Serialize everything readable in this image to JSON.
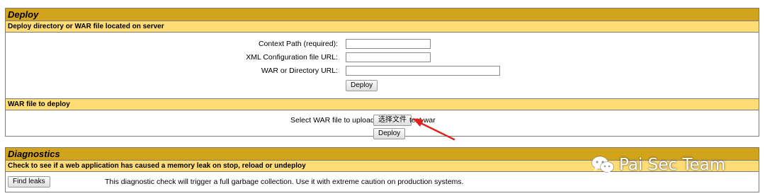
{
  "deploy": {
    "title": "Deploy",
    "server_section": {
      "title": "Deploy directory or WAR file located on server",
      "context_path_label": "Context Path (required):",
      "context_path_value": "",
      "xml_config_label": "XML Configuration file URL:",
      "xml_config_value": "",
      "war_dir_label": "WAR or Directory URL:",
      "war_dir_value": "",
      "deploy_button": "Deploy"
    },
    "upload_section": {
      "title": "WAR file to deploy",
      "select_label": "Select WAR file to upload",
      "choose_file_button": "选择文件",
      "selected_file": "test.war",
      "deploy_button": "Deploy"
    }
  },
  "diagnostics": {
    "title": "Diagnostics",
    "leak_section": {
      "title": "Check to see if a web application has caused a memory leak on stop, reload or undeploy",
      "find_leaks_button": "Find leaks",
      "description": "This diagnostic check will trigger a full garbage collection. Use it with extreme caution on production systems."
    }
  },
  "watermark": {
    "text": "Pai Sec Team",
    "icon": "wechat-icon"
  },
  "colors": {
    "header_main": "#d2a41c",
    "header_sub": "#ffdc75",
    "annotation_arrow": "#e0201b"
  }
}
